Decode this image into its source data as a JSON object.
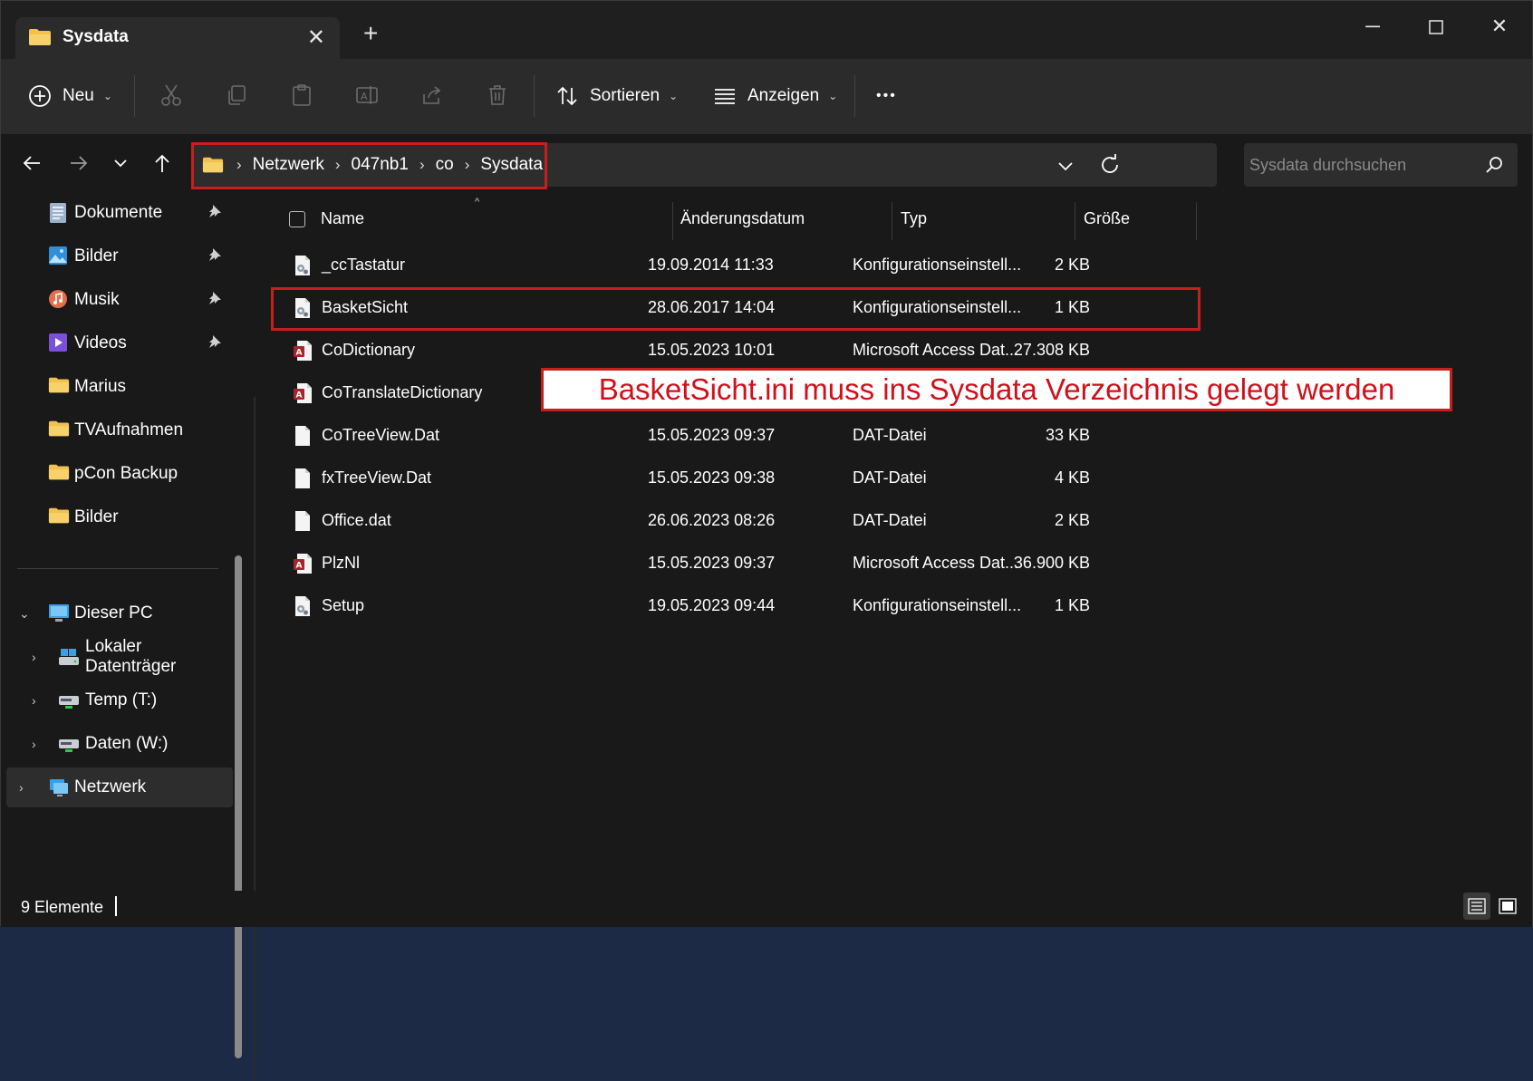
{
  "tab": {
    "title": "Sysdata"
  },
  "toolbar": {
    "new_label": "Neu",
    "sort_label": "Sortieren",
    "view_label": "Anzeigen",
    "more_label": "•••"
  },
  "address": {
    "crumbs": [
      "Netzwerk",
      "047nb1",
      "co",
      "Sysdata"
    ],
    "sep": "›"
  },
  "search": {
    "placeholder": "Sysdata durchsuchen"
  },
  "sidebar": {
    "quick": [
      {
        "label": "Dokumente",
        "icon": "documents-icon",
        "pinned": true
      },
      {
        "label": "Bilder",
        "icon": "pictures-icon",
        "pinned": true
      },
      {
        "label": "Musik",
        "icon": "music-icon",
        "pinned": true
      },
      {
        "label": "Videos",
        "icon": "videos-icon",
        "pinned": true
      },
      {
        "label": "Marius",
        "icon": "folder-icon",
        "pinned": false
      },
      {
        "label": "TVAufnahmen",
        "icon": "folder-icon",
        "pinned": false
      },
      {
        "label": "pCon Backup",
        "icon": "folder-icon",
        "pinned": false
      },
      {
        "label": "Bilder",
        "icon": "folder-icon",
        "pinned": false
      }
    ],
    "this_pc": "Dieser PC",
    "drives": [
      {
        "label": "Lokaler Datenträger"
      },
      {
        "label": "Temp (T:)"
      },
      {
        "label": "Daten (W:)"
      }
    ],
    "network": "Netzwerk"
  },
  "columns": {
    "name": "Name",
    "date": "Änderungsdatum",
    "type": "Typ",
    "size": "Größe"
  },
  "files": [
    {
      "name": "_ccTastatur",
      "date": "19.09.2014 11:33",
      "type": "Konfigurationseinstell...",
      "size": "2 KB",
      "icon": "ini-file-icon"
    },
    {
      "name": "BasketSicht",
      "date": "28.06.2017 14:04",
      "type": "Konfigurationseinstell...",
      "size": "1 KB",
      "icon": "ini-file-icon"
    },
    {
      "name": "CoDictionary",
      "date": "15.05.2023 10:01",
      "type": "Microsoft Access Dat...",
      "size": "27.308 KB",
      "icon": "access-file-icon"
    },
    {
      "name": "CoTranslateDictionary",
      "date": "",
      "type": "",
      "size": "",
      "icon": "access-file-icon"
    },
    {
      "name": "CoTreeView.Dat",
      "date": "15.05.2023 09:37",
      "type": "DAT-Datei",
      "size": "33 KB",
      "icon": "file-icon"
    },
    {
      "name": "fxTreeView.Dat",
      "date": "15.05.2023 09:38",
      "type": "DAT-Datei",
      "size": "4 KB",
      "icon": "file-icon"
    },
    {
      "name": "Office.dat",
      "date": "26.06.2023 08:26",
      "type": "DAT-Datei",
      "size": "2 KB",
      "icon": "file-icon"
    },
    {
      "name": "PlzNl",
      "date": "15.05.2023 09:37",
      "type": "Microsoft Access Dat...",
      "size": "36.900 KB",
      "icon": "access-file-icon"
    },
    {
      "name": "Setup",
      "date": "19.05.2023 09:44",
      "type": "Konfigurationseinstell...",
      "size": "1 KB",
      "icon": "ini-file-icon"
    }
  ],
  "annotation": "BasketSicht.ini muss ins Sysdata Verzeichnis gelegt werden",
  "status": {
    "count": "9 Elemente"
  },
  "colors": {
    "highlight": "#c81e1e",
    "annotation_text": "#d0101a",
    "folder": "#f2c14e"
  }
}
